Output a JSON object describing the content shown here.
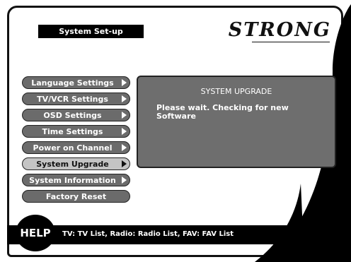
{
  "header": {
    "title": "System Set-up",
    "brand": "STRONG"
  },
  "menu": {
    "items": [
      {
        "label": "Language Settings",
        "arrow": true,
        "selected": false
      },
      {
        "label": "TV/VCR Settings",
        "arrow": true,
        "selected": false
      },
      {
        "label": "OSD Settings",
        "arrow": true,
        "selected": false
      },
      {
        "label": "Time Settings",
        "arrow": true,
        "selected": false
      },
      {
        "label": "Power on Channel",
        "arrow": true,
        "selected": false
      },
      {
        "label": "System Upgrade",
        "arrow": true,
        "selected": true
      },
      {
        "label": "System Information",
        "arrow": true,
        "selected": false
      },
      {
        "label": "Factory Reset",
        "arrow": false,
        "selected": false
      }
    ]
  },
  "panel": {
    "title": "SYSTEM UPGRADE",
    "message": "Please wait. Checking for new Software"
  },
  "help": {
    "badge": "HELP",
    "text": "TV: TV List, Radio: Radio List, FAV: FAV List"
  }
}
